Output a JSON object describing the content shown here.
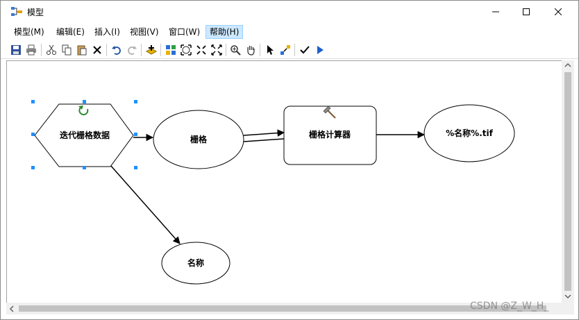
{
  "window": {
    "title": "模型",
    "buttons": {
      "minimize": "minimize-icon",
      "maximize": "maximize-icon",
      "close": "close-icon"
    }
  },
  "menu": [
    {
      "label": "模型(M)"
    },
    {
      "label": "编辑(E)"
    },
    {
      "label": "插入(I)"
    },
    {
      "label": "视图(V)"
    },
    {
      "label": "窗口(W)"
    },
    {
      "label": "帮助(H)",
      "active": true
    }
  ],
  "toolbar": {
    "icons": [
      "save-icon",
      "print-icon",
      "cut-icon",
      "copy-icon",
      "paste-icon",
      "delete-icon",
      "undo-icon",
      "redo-icon",
      "add-data-icon",
      "auto-layout-icon",
      "full-extent-icon",
      "zoom-in-fixed-icon",
      "zoom-out-fixed-icon",
      "zoom-icon",
      "pan-icon",
      "select-icon",
      "connect-icon",
      "validate-icon",
      "run-icon"
    ]
  },
  "model": {
    "nodes": {
      "iterator": {
        "label": "迭代栅格数据"
      },
      "raster": {
        "label": "栅格"
      },
      "calculator": {
        "label": "栅格计算器"
      },
      "output": {
        "label": "%名称%.tif"
      },
      "name": {
        "label": "名称"
      }
    }
  },
  "colors": {
    "selection_handle": "#1e90ff",
    "active_menu_bg": "#cce8ff",
    "active_menu_border": "#99d1ff",
    "iterator_arrow": "#2e8b2e"
  },
  "watermark": "CSDN @Z_W_H_"
}
